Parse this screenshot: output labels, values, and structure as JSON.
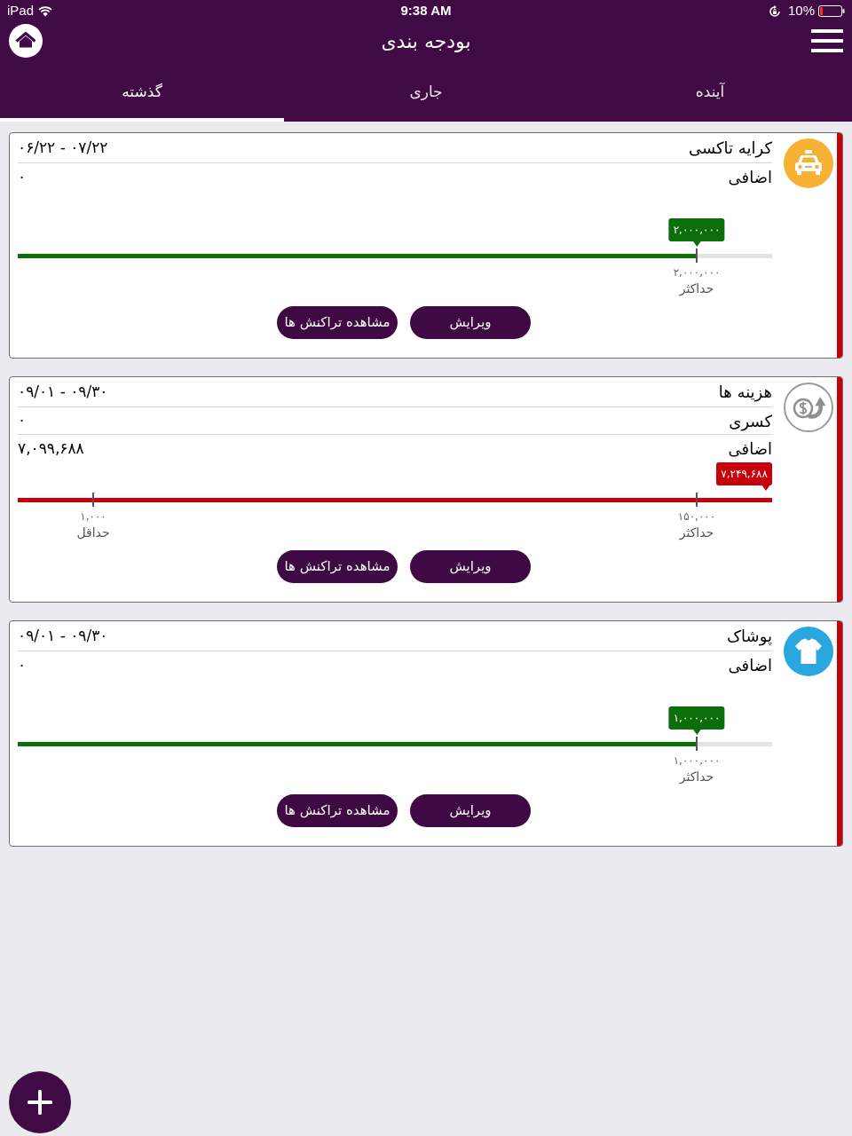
{
  "status_bar": {
    "carrier": "iPad",
    "time": "9:38 AM",
    "battery": "10%"
  },
  "header": {
    "title": "بودجه بندی"
  },
  "tabs": [
    {
      "label": "آینده",
      "selected": false
    },
    {
      "label": "جاری",
      "selected": false
    },
    {
      "label": "گذشته",
      "selected": true
    }
  ],
  "cards": [
    {
      "kind": "taxi",
      "name": "کرایه تاکسی",
      "period": "۰۶/۲۲ - ۰۷/۲۲",
      "rows": [
        {
          "label": "اضافی",
          "value": "۰"
        }
      ],
      "progress": {
        "level": 0.9,
        "color": "#0b6e0b",
        "bubble": "۲,۰۰۰,۰۰۰",
        "markers": [
          {
            "kind": "max",
            "value": "۲,۰۰۰,۰۰۰",
            "label": "حداکثر"
          }
        ]
      },
      "buttons": [
        "ویرایش",
        "مشاهده تراکنش ها"
      ]
    },
    {
      "kind": "money",
      "name": "هزینه ها",
      "period": "۰۹/۰۱ - ۰۹/۳۰",
      "rows": [
        {
          "label": "کسری",
          "value": "۰"
        },
        {
          "label": "اضافی",
          "value": "۷,۰۹۹,۶۸۸"
        }
      ],
      "progress": {
        "level": 1,
        "color": "#c8000a",
        "bubble": "۷,۲۴۹,۶۸۸",
        "markers": [
          {
            "kind": "max",
            "value": "۱۵۰,۰۰۰",
            "label": "حداکثر"
          },
          {
            "kind": "min",
            "value": "۱,۰۰۰",
            "label": "حداقل"
          }
        ]
      },
      "buttons": [
        "ویرایش",
        "مشاهده تراکنش ها"
      ]
    },
    {
      "kind": "clothing",
      "name": "پوشاک",
      "period": "۰۹/۰۱ - ۰۹/۳۰",
      "rows": [
        {
          "label": "اضافی",
          "value": "۰"
        }
      ],
      "progress": {
        "level": 0.9,
        "color": "#0b6e0b",
        "bubble": "۱,۰۰۰,۰۰۰",
        "markers": [
          {
            "kind": "max",
            "value": "۱,۰۰۰,۰۰۰",
            "label": "حداکثر"
          }
        ]
      },
      "buttons": [
        "ویرایش",
        "مشاهده تراکنش ها"
      ]
    }
  ]
}
